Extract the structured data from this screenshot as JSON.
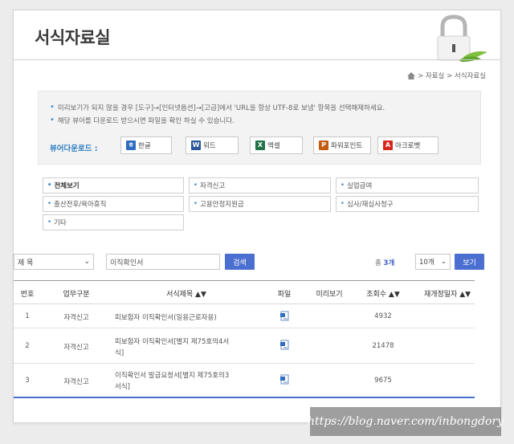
{
  "page": {
    "title": "서식자료실",
    "breadcrumb": "> 자료실 > 서식자료실"
  },
  "notice": {
    "line1": "미리보기가 되지 않을 경우 [도구]→[인터넷옵션]→[고급]에서 'URL을 항상 UTF-8로 보냄' 항목을 선택해제하세요.",
    "line2": "해당 뷰어를 다운로드 받으시면 파일을 확인 하실 수 있습니다.",
    "viewer_label": "뷰어다운로드 :",
    "viewers": [
      {
        "label": "한글",
        "icon": "hwp-icon",
        "color": "#2f6dbf"
      },
      {
        "label": "워드",
        "icon": "word-icon",
        "color": "#2b579a"
      },
      {
        "label": "엑셀",
        "icon": "excel-icon",
        "color": "#217346"
      },
      {
        "label": "파워포인트",
        "icon": "powerpoint-icon",
        "color": "#c55a11"
      },
      {
        "label": "아크로벳",
        "icon": "acrobat-icon",
        "color": "#d9251c"
      }
    ]
  },
  "categories": [
    {
      "label": "전체보기",
      "active": true
    },
    {
      "label": "자격신고",
      "active": false
    },
    {
      "label": "실업급여",
      "active": false
    },
    {
      "label": "출산전후/육아휴직",
      "active": false
    },
    {
      "label": "고용안정지원금",
      "active": false
    },
    {
      "label": "심사/재심사청구",
      "active": false
    },
    {
      "label": "기타",
      "active": false
    }
  ],
  "search": {
    "field": "제 목",
    "query": "이직확인서",
    "button": "검색",
    "total_prefix": "총",
    "total_count": "3개",
    "page_size": "10개",
    "view_button": "보기"
  },
  "table": {
    "headers": [
      "번호",
      "업무구분",
      "서식제목 ▲▼",
      "파일",
      "미리보기",
      "조회수 ▲▼",
      "재개정일자 ▲▼"
    ],
    "rows": [
      {
        "no": "1",
        "category": "자격신고",
        "title_l1": "피보험자 이직확인서(일용근로자용)",
        "title_l2": "",
        "views": "4932"
      },
      {
        "no": "2",
        "category": "자격신고",
        "title_l1": "피보험자 이직확인서[별지 제75호의4서",
        "title_l2": "식]",
        "views": "21478"
      },
      {
        "no": "3",
        "category": "자격신고",
        "title_l1": "이직확인서 발급요청서[별지 제75호의3",
        "title_l2": "서식]",
        "views": "9675"
      }
    ]
  },
  "watermark": "https://blog.naver.com/inbongdory",
  "colors": {
    "accent": "#4b6fd1",
    "link": "#2f7fc1"
  }
}
